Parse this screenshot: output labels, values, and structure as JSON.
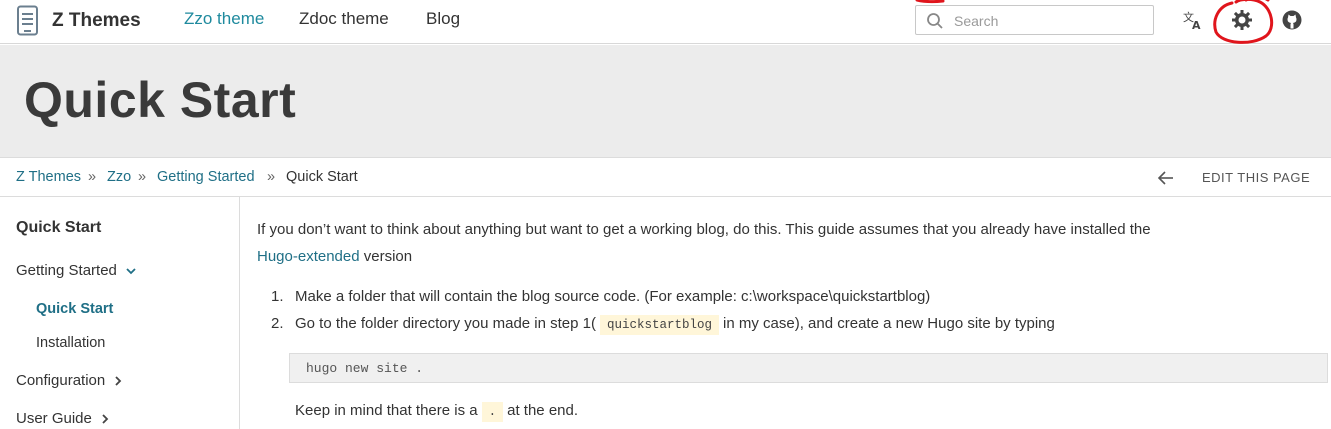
{
  "header": {
    "brand": "Z Themes",
    "nav": [
      "Zzo theme",
      "Zdoc theme",
      "Blog"
    ],
    "search_placeholder": "Search",
    "icons": [
      "translate-icon",
      "gear-icon",
      "github-icon"
    ]
  },
  "hero": {
    "title": "Quick Start"
  },
  "breadcrumb": {
    "items": [
      "Z Themes",
      "Zzo",
      "Getting Started",
      "Quick Start"
    ],
    "separator": "»",
    "edit_label": "EDIT THIS PAGE"
  },
  "sidebar": {
    "title": "Quick Start",
    "items": [
      {
        "label": "Getting Started",
        "expanded": true
      },
      {
        "label": "Quick Start",
        "active": true
      },
      {
        "label": "Installation"
      },
      {
        "label": "Configuration",
        "expanded": false
      },
      {
        "label": "User Guide",
        "expanded": false
      }
    ]
  },
  "content": {
    "intro": "If you don’t want to think about anything but want to get a working blog, do this. This guide assumes that you already have installed the",
    "intro_link": "Hugo-extended",
    "intro_tail": " version",
    "steps": [
      {
        "num": "1.",
        "text": "Make a folder that will contain the blog source code. (For example: c:\\workspace\\quickstartblog)"
      },
      {
        "num": "2.",
        "text_before": "Go to the folder directory you made in step 1(",
        "code": "quickstartblog",
        "text_after": "in my case), and create a new Hugo site by typing"
      }
    ],
    "code_block": "hugo new site .",
    "note_before": "Keep in mind that there is a",
    "note_code": ".",
    "note_after": "at the end."
  },
  "colors": {
    "accent": "#1f8a9e",
    "link": "#1f6f86",
    "hero_bg": "#ececec",
    "annotation": "#e0151c"
  }
}
